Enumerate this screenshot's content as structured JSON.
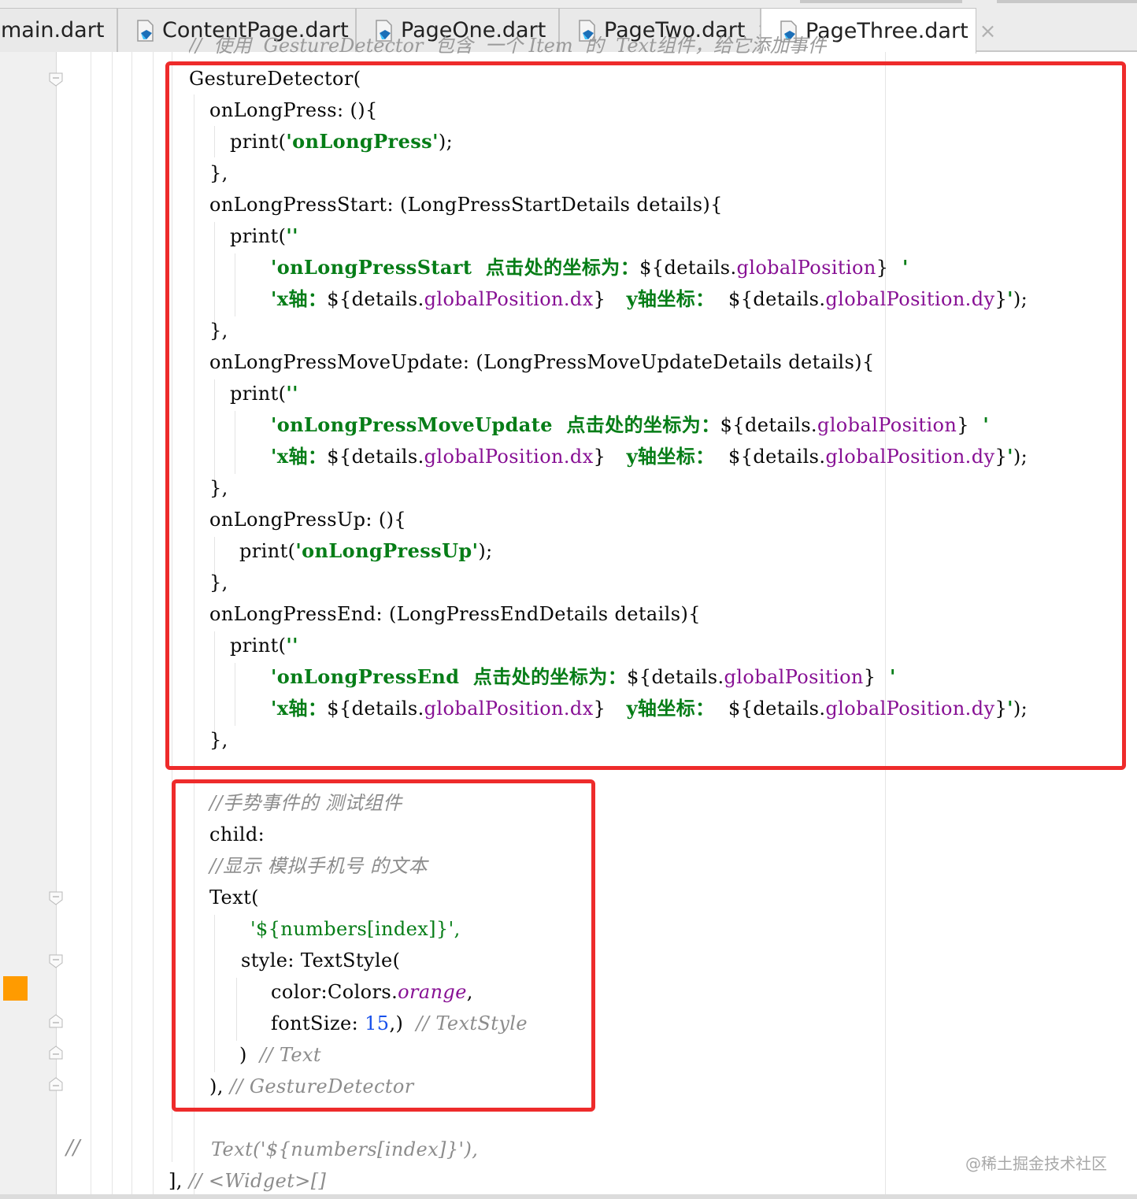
{
  "tabs": [
    {
      "label": "main.dart",
      "close": "×",
      "active": false
    },
    {
      "label": "ContentPage.dart",
      "close": "×",
      "active": false
    },
    {
      "label": "PageOne.dart",
      "close": "×",
      "active": false
    },
    {
      "label": "PageTwo.dart",
      "close": "×",
      "active": false
    },
    {
      "label": "PageThree.dart",
      "close": "×",
      "active": true
    }
  ],
  "code": {
    "top_cut": "//  使用  GestureDetector  包含  一个 Item  的  Text组件，给它添加事件",
    "l01": "GestureDetector(",
    "l02": "onLongPress: (){",
    "l03": {
      "a": "print(",
      "s": "'onLongPress'",
      "b": ");"
    },
    "l04": "},",
    "l05": "onLongPressStart: (LongPressStartDetails details){",
    "l06": {
      "a": "print(",
      "s": "''"
    },
    "l07": {
      "s1": "'onLongPressStart  点击处的坐标为：",
      "a": "${details.",
      "p": "globalPosition",
      "b": "}",
      "s2": "  '"
    },
    "l08": {
      "s1": "'x轴：",
      "a": "${details.",
      "p1": "globalPosition.dx",
      "b": "}",
      "s2": "   y轴坐标：  ",
      "c": "${details.",
      "p2": "globalPosition.dy",
      "d": "}",
      "s3": "'",
      "e": ");"
    },
    "l09": "},",
    "l10": "onLongPressMoveUpdate: (LongPressMoveUpdateDetails details){",
    "l11": {
      "a": "print(",
      "s": "''"
    },
    "l12": {
      "s1": "'onLongPressMoveUpdate  点击处的坐标为：",
      "a": "${details.",
      "p": "globalPosition",
      "b": "}",
      "s2": "  '"
    },
    "l13": {
      "s1": "'x轴：",
      "a": "${details.",
      "p1": "globalPosition.dx",
      "b": "}",
      "s2": "   y轴坐标：  ",
      "c": "${details.",
      "p2": "globalPosition.dy",
      "d": "}",
      "s3": "'",
      "e": ");"
    },
    "l14": "},",
    "l15": "onLongPressUp: (){",
    "l16": {
      "a": "print(",
      "s": "'onLongPressUp'",
      "b": ");"
    },
    "l17": "},",
    "l18": "onLongPressEnd: (LongPressEndDetails details){",
    "l19": {
      "a": "print(",
      "s": "''"
    },
    "l20": {
      "s1": "'onLongPressEnd  点击处的坐标为：",
      "a": "${details.",
      "p": "globalPosition",
      "b": "}",
      "s2": "  '"
    },
    "l21": {
      "s1": "'x轴：",
      "a": "${details.",
      "p1": "globalPosition.dx",
      "b": "}",
      "s2": "   y轴坐标：  ",
      "c": "${details.",
      "p2": "globalPosition.dy",
      "d": "}",
      "s3": "'",
      "e": ");"
    },
    "l22": "},",
    "l23": "//手势事件的 测试组件",
    "l24": "child:",
    "l25": "//显示 模拟手机号 的文本",
    "l26": "Text(",
    "l27": "'${numbers[index]}',",
    "l28": "style: TextStyle(",
    "l29": {
      "a": "color:Colors.",
      "i": "orange",
      "b": ","
    },
    "l30": {
      "a": "fontSize: ",
      "n": "15",
      "b": ",)",
      "c": "// TextStyle"
    },
    "l31": {
      "a": ")",
      "c": "// Text"
    },
    "l32": {
      "a": "),",
      "c": "// GestureDetector"
    },
    "l33": "Text('${numbers[index]}'),",
    "l34": {
      "a": "],",
      "c": "// <Widget>[]"
    },
    "gutter_comment": "//"
  },
  "watermark": "@稀土掘金技术社区",
  "colors": {
    "highlight_box": "#ee2b2b",
    "string": "#067d17",
    "property": "#871094",
    "number": "#1750eb",
    "comment": "#8c8c8c",
    "gutter_marker": "#ff9b00"
  }
}
